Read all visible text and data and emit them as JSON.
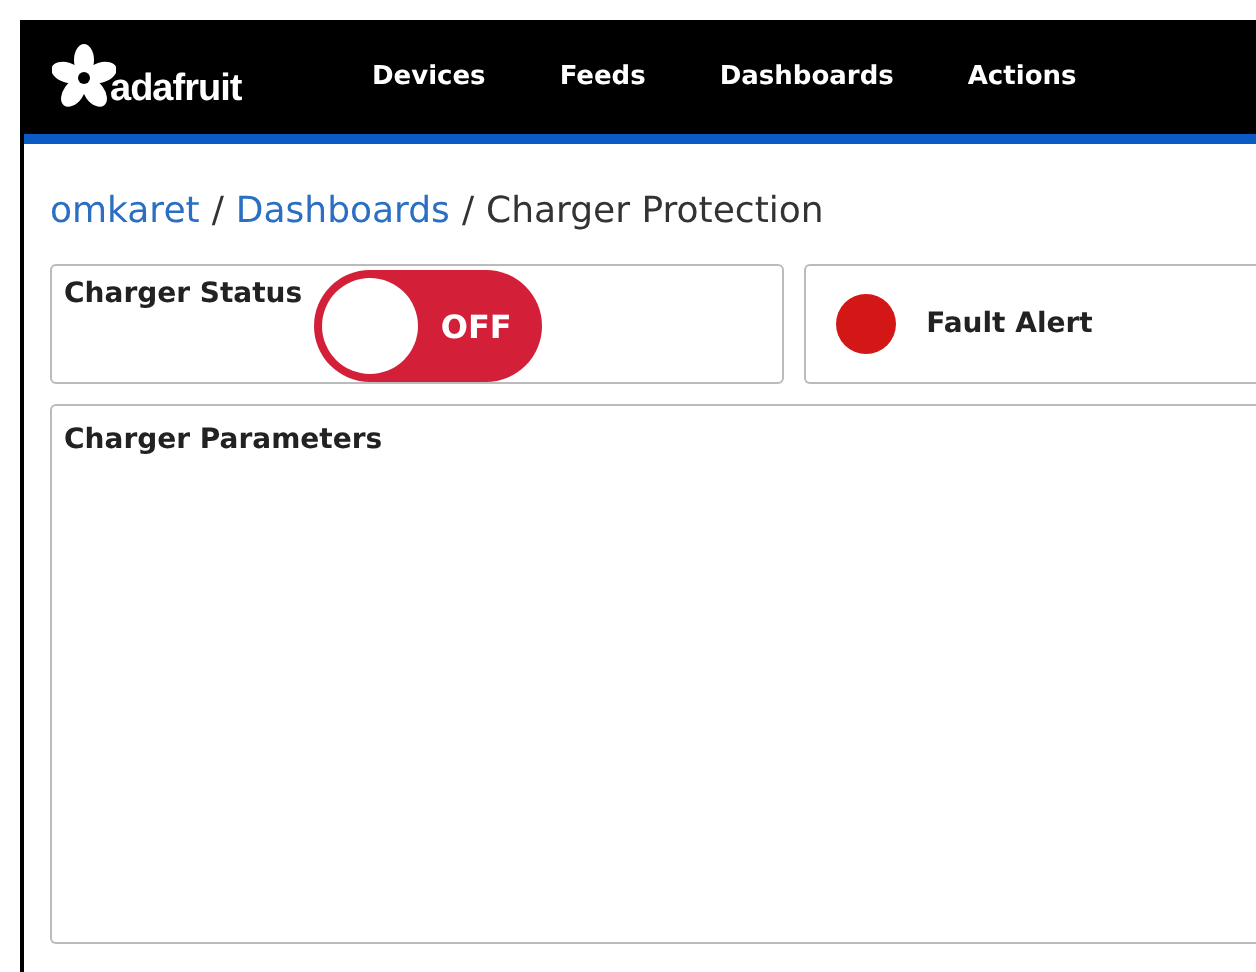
{
  "nav": {
    "brand": "adafruit",
    "items": [
      {
        "label": "Devices"
      },
      {
        "label": "Feeds"
      },
      {
        "label": "Dashboards"
      },
      {
        "label": "Actions"
      }
    ]
  },
  "breadcrumb": {
    "links": [
      {
        "label": "omkaret",
        "separator": "/"
      },
      {
        "label": "Dashboards",
        "separator": "/"
      }
    ],
    "current": "Charger Protection"
  },
  "toggle_block": {
    "title": "Charger Status",
    "on": false,
    "state_label": "OFF"
  },
  "indicator_block": {
    "label": "Fault Alert",
    "on": true
  },
  "text_block": {
    "title": "Charger Parameters"
  }
}
